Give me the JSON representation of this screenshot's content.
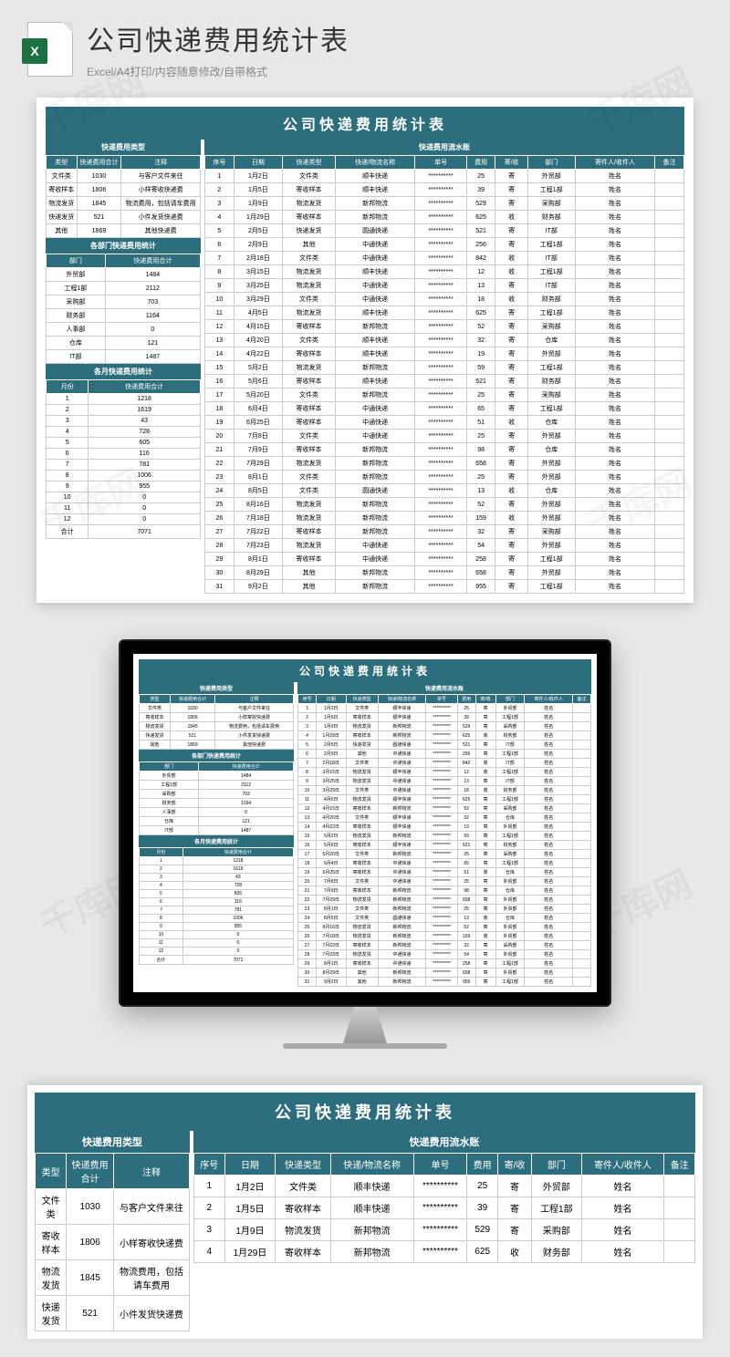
{
  "header": {
    "title": "公司快递费用统计表",
    "subtitle": "Excel/A4打印/内容随意修改/自带格式",
    "icon_label": "X"
  },
  "main_title": "公司快递费用统计表",
  "watermark": "千库网",
  "left_tables": {
    "type": {
      "title": "快递费用类型",
      "cols": [
        "类型",
        "快递费用合计",
        "注释"
      ],
      "rows": [
        [
          "文件类",
          "1030",
          "与客户文件来往"
        ],
        [
          "寄收样本",
          "1806",
          "小样寄收快递费"
        ],
        [
          "物流发货",
          "1845",
          "物流费用，包括请车费用"
        ],
        [
          "快递发货",
          "521",
          "小件发货快递费"
        ],
        [
          "其他",
          "1869",
          "其他快递费"
        ]
      ]
    },
    "dept": {
      "title": "各部门快递费用统计",
      "cols": [
        "部门",
        "快递费用合计"
      ],
      "rows": [
        [
          "外贸部",
          "1484"
        ],
        [
          "工程1部",
          "2112"
        ],
        [
          "采购部",
          "703"
        ],
        [
          "财务部",
          "1164"
        ],
        [
          "人事部",
          "0"
        ],
        [
          "仓库",
          "121"
        ],
        [
          "IT部",
          "1487"
        ]
      ]
    },
    "month": {
      "title": "各月快递费用统计",
      "cols": [
        "月份",
        "快递费用合计"
      ],
      "rows": [
        [
          "1",
          "1218"
        ],
        [
          "2",
          "1619"
        ],
        [
          "3",
          "43"
        ],
        [
          "4",
          "728"
        ],
        [
          "5",
          "605"
        ],
        [
          "6",
          "116"
        ],
        [
          "7",
          "781"
        ],
        [
          "8",
          "1006"
        ],
        [
          "9",
          "955"
        ],
        [
          "10",
          "0"
        ],
        [
          "11",
          "0"
        ],
        [
          "12",
          "0"
        ],
        [
          "合计",
          "7071"
        ]
      ]
    }
  },
  "right_table": {
    "title": "快递费用流水账",
    "cols": [
      "序号",
      "日期",
      "快递类型",
      "快递/物流名称",
      "单号",
      "费用",
      "寄/收",
      "部门",
      "寄件人/收件人",
      "备注"
    ],
    "rows": [
      [
        "1",
        "1月2日",
        "文件类",
        "顺丰快递",
        "**********",
        "25",
        "寄",
        "外贸部",
        "姓名",
        ""
      ],
      [
        "2",
        "1月5日",
        "寄收样本",
        "顺丰快递",
        "**********",
        "39",
        "寄",
        "工程1部",
        "姓名",
        ""
      ],
      [
        "3",
        "1月9日",
        "物流发货",
        "新邦物流",
        "**********",
        "529",
        "寄",
        "采购部",
        "姓名",
        ""
      ],
      [
        "4",
        "1月29日",
        "寄收样本",
        "新邦物流",
        "**********",
        "625",
        "收",
        "财务部",
        "姓名",
        ""
      ],
      [
        "5",
        "2月5日",
        "快递发货",
        "圆通快递",
        "**********",
        "521",
        "寄",
        "IT部",
        "姓名",
        ""
      ],
      [
        "6",
        "2月9日",
        "其他",
        "中通快递",
        "**********",
        "256",
        "寄",
        "工程1部",
        "姓名",
        ""
      ],
      [
        "7",
        "2月18日",
        "文件类",
        "中通快递",
        "**********",
        "842",
        "收",
        "IT部",
        "姓名",
        ""
      ],
      [
        "8",
        "3月15日",
        "物流发货",
        "顺丰快递",
        "**********",
        "12",
        "收",
        "工程1部",
        "姓名",
        ""
      ],
      [
        "9",
        "3月25日",
        "物流发货",
        "中通快递",
        "**********",
        "13",
        "寄",
        "IT部",
        "姓名",
        ""
      ],
      [
        "10",
        "3月29日",
        "文件类",
        "中通快递",
        "**********",
        "18",
        "收",
        "财务部",
        "姓名",
        ""
      ],
      [
        "11",
        "4月5日",
        "物流发货",
        "顺丰快递",
        "**********",
        "625",
        "寄",
        "工程1部",
        "姓名",
        ""
      ],
      [
        "12",
        "4月15日",
        "寄收样本",
        "新邦物流",
        "**********",
        "52",
        "寄",
        "采购部",
        "姓名",
        ""
      ],
      [
        "13",
        "4月20日",
        "文件类",
        "顺丰快递",
        "**********",
        "32",
        "寄",
        "仓库",
        "姓名",
        ""
      ],
      [
        "14",
        "4月22日",
        "寄收样本",
        "顺丰快递",
        "**********",
        "19",
        "寄",
        "外贸部",
        "姓名",
        ""
      ],
      [
        "15",
        "5月2日",
        "物流发货",
        "新邦物流",
        "**********",
        "59",
        "寄",
        "工程1部",
        "姓名",
        ""
      ],
      [
        "16",
        "5月6日",
        "寄收样本",
        "顺丰快递",
        "**********",
        "521",
        "寄",
        "财务部",
        "姓名",
        ""
      ],
      [
        "17",
        "5月20日",
        "文件类",
        "新邦物流",
        "**********",
        "25",
        "寄",
        "采购部",
        "姓名",
        ""
      ],
      [
        "18",
        "6月4日",
        "寄收样本",
        "中通快递",
        "**********",
        "65",
        "寄",
        "工程1部",
        "姓名",
        ""
      ],
      [
        "19",
        "6月25日",
        "寄收样本",
        "中通快递",
        "**********",
        "51",
        "收",
        "仓库",
        "姓名",
        ""
      ],
      [
        "20",
        "7月8日",
        "文件类",
        "中通快递",
        "**********",
        "25",
        "寄",
        "外贸部",
        "姓名",
        ""
      ],
      [
        "21",
        "7月9日",
        "寄收样本",
        "新邦物流",
        "**********",
        "98",
        "寄",
        "仓库",
        "姓名",
        ""
      ],
      [
        "22",
        "7月29日",
        "物流发货",
        "新邦物流",
        "**********",
        "658",
        "寄",
        "外贸部",
        "姓名",
        ""
      ],
      [
        "23",
        "8月1日",
        "文件类",
        "新邦物流",
        "**********",
        "25",
        "寄",
        "外贸部",
        "姓名",
        ""
      ],
      [
        "24",
        "8月5日",
        "文件类",
        "圆通快递",
        "**********",
        "13",
        "收",
        "仓库",
        "姓名",
        ""
      ],
      [
        "25",
        "8月16日",
        "物流发货",
        "新邦物流",
        "**********",
        "52",
        "寄",
        "外贸部",
        "姓名",
        ""
      ],
      [
        "26",
        "7月18日",
        "物流发货",
        "新邦物流",
        "**********",
        "159",
        "收",
        "外贸部",
        "姓名",
        ""
      ],
      [
        "27",
        "7月22日",
        "寄收样本",
        "新邦物流",
        "**********",
        "32",
        "寄",
        "采购部",
        "姓名",
        ""
      ],
      [
        "28",
        "7月23日",
        "物流发货",
        "中通快递",
        "**********",
        "54",
        "寄",
        "外贸部",
        "姓名",
        ""
      ],
      [
        "29",
        "8月1日",
        "寄收样本",
        "中通快递",
        "**********",
        "258",
        "寄",
        "工程1部",
        "姓名",
        ""
      ],
      [
        "30",
        "8月29日",
        "其他",
        "新邦物流",
        "**********",
        "658",
        "寄",
        "外贸部",
        "姓名",
        ""
      ],
      [
        "31",
        "9月2日",
        "其他",
        "新邦物流",
        "**********",
        "955",
        "寄",
        "工程1部",
        "姓名",
        ""
      ]
    ]
  },
  "bottom_rows": 4
}
